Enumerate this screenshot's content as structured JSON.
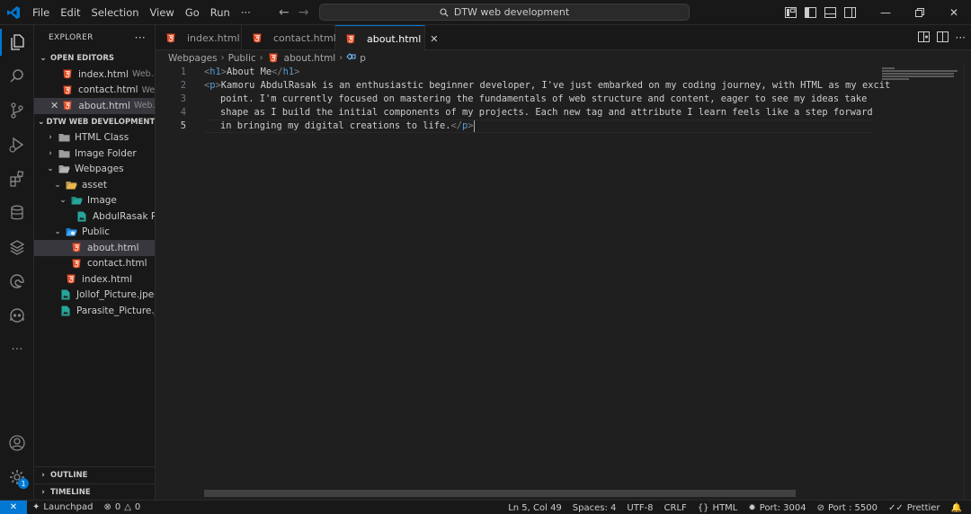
{
  "menu": [
    "File",
    "Edit",
    "Selection",
    "View",
    "Go",
    "Run",
    "···"
  ],
  "command_center": {
    "text": "DTW web development"
  },
  "explorer": {
    "title": "EXPLORER",
    "more": "···",
    "open_editors_title": "OPEN EDITORS",
    "open_editors": [
      {
        "name": "index.html",
        "desc": "Web..."
      },
      {
        "name": "contact.html",
        "desc": "We..."
      },
      {
        "name": "about.html",
        "desc": "Web..."
      }
    ],
    "project_title": "DTW WEB DEVELOPMENT",
    "tree": [
      {
        "name": "HTML Class"
      },
      {
        "name": "Image Folder"
      },
      {
        "name": "Webpages"
      },
      {
        "name": "asset"
      },
      {
        "name": "Image"
      },
      {
        "name": "AbdulRasak P..."
      },
      {
        "name": "Public"
      },
      {
        "name": "about.html"
      },
      {
        "name": "contact.html"
      },
      {
        "name": "index.html"
      },
      {
        "name": "Jollof_Picture.jpeg"
      },
      {
        "name": "Parasite_Picture.jp..."
      }
    ],
    "outline": "OUTLINE",
    "timeline": "TIMELINE"
  },
  "tabs": [
    {
      "label": "index.html"
    },
    {
      "label": "contact.html"
    },
    {
      "label": "about.html"
    }
  ],
  "breadcrumbs": [
    "Webpages",
    "Public",
    "about.html",
    "p"
  ],
  "code": {
    "line_numbers": [
      "1",
      "2",
      "3",
      "4",
      "5"
    ],
    "l1_open": "<",
    "l1_tag": "h1",
    "l1_close": ">",
    "l1_text": "About Me",
    "l1_end_open": "</",
    "l1_end_tag": "h1",
    "l1_end_close": ">",
    "l2_open": "<",
    "l2_tag": "p",
    "l2_close": ">",
    "l2_text": "Kamoru AbdulRasak is an enthusiastic beginner developer, I've just embarked on my coding journey, with HTML as my excit",
    "l3_text": "point. I'm currently focused on mastering the fundamentals of web structure and content, eager to see my ideas take",
    "l4_text": "shape as I build the initial components of my projects. Each new tag and attribute I learn feels like a step forward",
    "l5_text": "in bringing my digital creations to life.",
    "l5_end_open": "</",
    "l5_end_tag": "p",
    "l5_end_close": ">"
  },
  "status": {
    "remote": "✕",
    "launchpad": "Launchpad",
    "errors": "0",
    "warnings": "0",
    "position": "Ln 5, Col 49",
    "spaces": "Spaces: 4",
    "encoding": "UTF-8",
    "eol": "CRLF",
    "language": "HTML",
    "port1": "Port: 3004",
    "port2": "Port : 5500",
    "prettier": "Prettier"
  },
  "colors": {
    "accent": "#0078d4",
    "html_icon": "#e44d26",
    "folder": "#c09553",
    "image_icon": "#26a69a",
    "tag": "#569cd6"
  }
}
